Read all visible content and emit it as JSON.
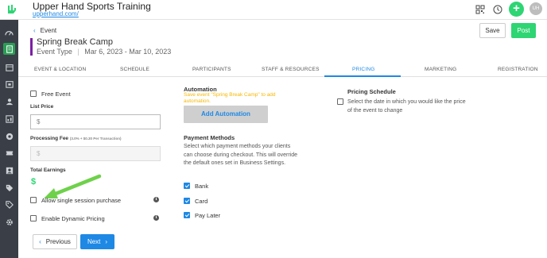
{
  "app": {
    "title": "Upper Hand Sports Training",
    "url": "upperhand.com/",
    "avatar_initials": "UH",
    "plus_label": "+"
  },
  "colors": {
    "accent": "#1e88e5",
    "green": "#2ed573",
    "sidebar": "#3a3f47",
    "warning": "#f6b800"
  },
  "topbar_icons": [
    "qr-scan-icon",
    "clock-icon"
  ],
  "sidebar_icons": [
    "dashboard-icon",
    "events-icon",
    "calendar-icon",
    "schedule-icon",
    "clients-icon",
    "reports-icon",
    "marketing-icon",
    "tickets-icon",
    "staff-icon",
    "tag-icon",
    "discount-icon",
    "settings-icon"
  ],
  "header": {
    "back_label": "Event",
    "event_title": "Spring Break Camp",
    "event_type": "Event Type",
    "event_dates": "Mar 6, 2023 - Mar 10, 2023",
    "save_label": "Save",
    "post_label": "Post"
  },
  "tabs": [
    "EVENT & LOCATION",
    "SCHEDULE",
    "PARTICIPANTS",
    "STAFF & RESOURCES",
    "PRICING",
    "MARKETING",
    "REGISTRATION"
  ],
  "active_tab": "PRICING",
  "pricing": {
    "free_event_label": "Free Event",
    "free_event_checked": false,
    "list_price_label": "List Price",
    "list_price_placeholder": "$",
    "processing_fee_label": "Processing Fee",
    "processing_fee_hint": "(3.0% + $0.30 Per Transaction)",
    "processing_fee_placeholder": "$",
    "total_earnings_label": "Total Earnings",
    "total_earnings_value": "$",
    "single_session_label": "Allow single session purchase",
    "dynamic_pricing_label": "Enable Dynamic Pricing",
    "info_glyph": "i"
  },
  "automation": {
    "title": "Automation",
    "warning": "Save event \"Spring Break Camp\" to add automation.",
    "button_label": "Add Automation"
  },
  "payment_methods": {
    "title": "Payment Methods",
    "description": "Select which payment methods your clients can choose during checkout. This will override the default ones set in Business Settings.",
    "options": [
      {
        "label": "Bank",
        "checked": true
      },
      {
        "label": "Card",
        "checked": true
      },
      {
        "label": "Pay Later",
        "checked": true
      }
    ]
  },
  "pricing_schedule": {
    "title": "Pricing Schedule",
    "description": "Select the date in which you would like the price of the event to change",
    "checked": false
  },
  "footer": {
    "previous_label": "Previous",
    "next_label": "Next"
  }
}
